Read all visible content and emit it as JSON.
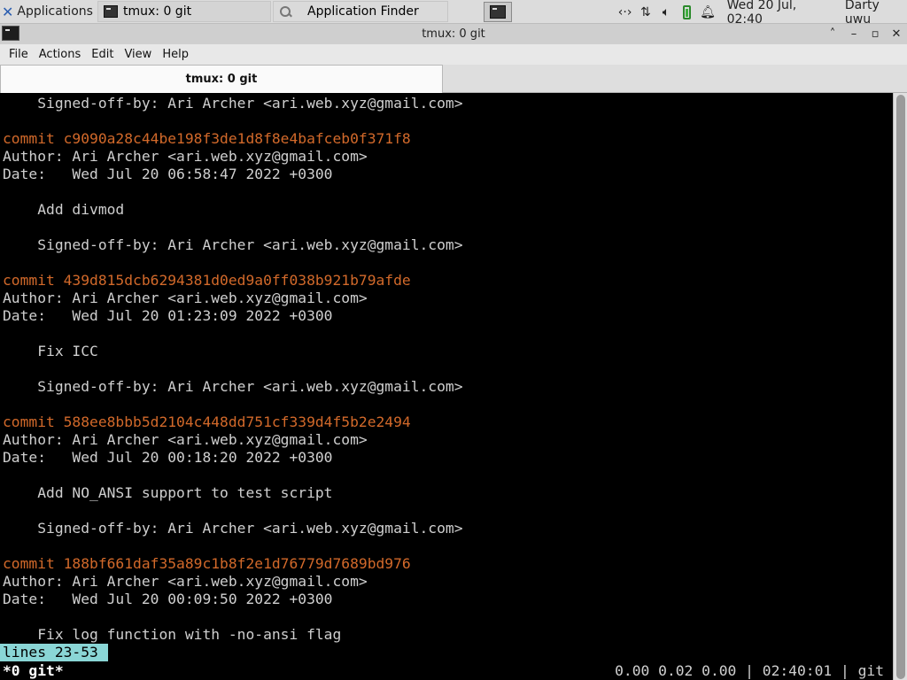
{
  "panel": {
    "apps_label": "Applications",
    "tasks": [
      {
        "label": "tmux: 0 git"
      },
      {
        "label": "Application Finder"
      }
    ],
    "tray": {
      "clock": "Wed 20 Jul, 02:40",
      "user": "Darty uwu"
    }
  },
  "window": {
    "title": "tmux: 0 git",
    "buttons": {
      "up": "˄",
      "minimize": "–",
      "maximize": "▫",
      "close": "✕"
    }
  },
  "menubar": [
    "File",
    "Actions",
    "Edit",
    "View",
    "Help"
  ],
  "tabs": [
    {
      "label": "tmux: 0 git"
    }
  ],
  "terminal": {
    "lines": [
      {
        "text": "    Signed-off-by: Ari Archer <ari.web.xyz@gmail.com>",
        "type": "text"
      },
      {
        "text": "",
        "type": "text"
      },
      {
        "text": "commit c9090a28c44be198f3de1d8f8e4bafceb0f371f8",
        "type": "commit"
      },
      {
        "text": "Author: Ari Archer <ari.web.xyz@gmail.com>",
        "type": "text"
      },
      {
        "text": "Date:   Wed Jul 20 06:58:47 2022 +0300",
        "type": "text"
      },
      {
        "text": "",
        "type": "text"
      },
      {
        "text": "    Add divmod",
        "type": "text"
      },
      {
        "text": "",
        "type": "text"
      },
      {
        "text": "    Signed-off-by: Ari Archer <ari.web.xyz@gmail.com>",
        "type": "text"
      },
      {
        "text": "",
        "type": "text"
      },
      {
        "text": "commit 439d815dcb6294381d0ed9a0ff038b921b79afde",
        "type": "commit"
      },
      {
        "text": "Author: Ari Archer <ari.web.xyz@gmail.com>",
        "type": "text"
      },
      {
        "text": "Date:   Wed Jul 20 01:23:09 2022 +0300",
        "type": "text"
      },
      {
        "text": "",
        "type": "text"
      },
      {
        "text": "    Fix ICC",
        "type": "text"
      },
      {
        "text": "",
        "type": "text"
      },
      {
        "text": "    Signed-off-by: Ari Archer <ari.web.xyz@gmail.com>",
        "type": "text"
      },
      {
        "text": "",
        "type": "text"
      },
      {
        "text": "commit 588ee8bbb5d2104c448dd751cf339d4f5b2e2494",
        "type": "commit"
      },
      {
        "text": "Author: Ari Archer <ari.web.xyz@gmail.com>",
        "type": "text"
      },
      {
        "text": "Date:   Wed Jul 20 00:18:20 2022 +0300",
        "type": "text"
      },
      {
        "text": "",
        "type": "text"
      },
      {
        "text": "    Add NO_ANSI support to test script",
        "type": "text"
      },
      {
        "text": "",
        "type": "text"
      },
      {
        "text": "    Signed-off-by: Ari Archer <ari.web.xyz@gmail.com>",
        "type": "text"
      },
      {
        "text": "",
        "type": "text"
      },
      {
        "text": "commit 188bf661daf35a89c1b8f2e1d76779d7689bd976",
        "type": "commit"
      },
      {
        "text": "Author: Ari Archer <ari.web.xyz@gmail.com>",
        "type": "text"
      },
      {
        "text": "Date:   Wed Jul 20 00:09:50 2022 +0300",
        "type": "text"
      },
      {
        "text": "",
        "type": "text"
      },
      {
        "text": "    Fix log function with -no-ansi flag",
        "type": "text"
      }
    ],
    "pager_status": "lines 23-53",
    "tmux_window": "*0 git*",
    "tmux_right": "0.00 0.02 0.00 | 02:40:01 | git"
  },
  "colors": {
    "commit": "#d2692a",
    "text": "#cfcfcf",
    "pager_status_bg": "#8ad6d6"
  },
  "icons": {
    "apps": "xfce-logo-icon",
    "terminal": "terminal-icon",
    "finder": "search-icon",
    "network": "network-arrows-icon",
    "transfer": "updown-arrows-icon",
    "volume": "speaker-icon",
    "battery": "battery-icon",
    "notifications": "bell-icon"
  }
}
